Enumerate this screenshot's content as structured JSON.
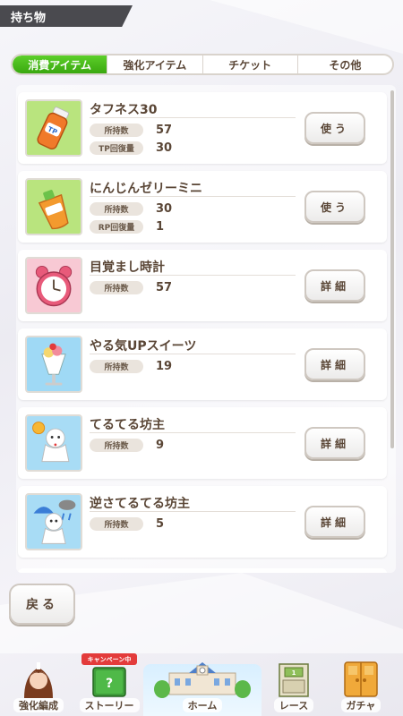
{
  "header": {
    "title": "持ち物"
  },
  "tabs": [
    {
      "label": "消費アイテム",
      "active": true
    },
    {
      "label": "強化アイテム",
      "active": false
    },
    {
      "label": "チケット",
      "active": false
    },
    {
      "label": "その他",
      "active": false
    }
  ],
  "items": [
    {
      "name": "タフネス30",
      "icon": "tp-drink-icon",
      "action": "使う",
      "stats": [
        {
          "label": "所持数",
          "value": "57"
        },
        {
          "label": "TP回復量",
          "value": "30"
        }
      ]
    },
    {
      "name": "にんじんゼリーミニ",
      "icon": "carrot-jelly-icon",
      "action": "使う",
      "stats": [
        {
          "label": "所持数",
          "value": "30"
        },
        {
          "label": "RP回復量",
          "value": "1"
        }
      ]
    },
    {
      "name": "目覚まし時計",
      "icon": "alarm-clock-icon",
      "action": "詳細",
      "stats": [
        {
          "label": "所持数",
          "value": "57"
        }
      ]
    },
    {
      "name": "やる気UPスイーツ",
      "icon": "parfait-icon",
      "action": "詳細",
      "stats": [
        {
          "label": "所持数",
          "value": "19"
        }
      ]
    },
    {
      "name": "てるてる坊主",
      "icon": "teru-teru-bozu-icon",
      "action": "詳細",
      "stats": [
        {
          "label": "所持数",
          "value": "9"
        }
      ]
    },
    {
      "name": "逆さてるてる坊主",
      "icon": "upside-down-teru-teru-bozu-icon",
      "action": "詳細",
      "stats": [
        {
          "label": "所持数",
          "value": "5"
        }
      ]
    }
  ],
  "back_button": {
    "label": "戻る"
  },
  "bottom_nav": {
    "campaign_badge": "キャンペーン中",
    "items": [
      {
        "label": "強化編成",
        "icon": "character-portrait-icon"
      },
      {
        "label": "ストーリー",
        "icon": "story-book-icon"
      },
      {
        "label": "ホーム",
        "icon": "home-building-icon"
      },
      {
        "label": "レース",
        "icon": "race-gate-icon"
      },
      {
        "label": "ガチャ",
        "icon": "gacha-door-icon"
      }
    ]
  },
  "colors": {
    "accent_green": "#3aa80f",
    "header_bg": "#4a4a4f",
    "text_brown": "#5a4636",
    "badge_red": "#e33b3b"
  }
}
